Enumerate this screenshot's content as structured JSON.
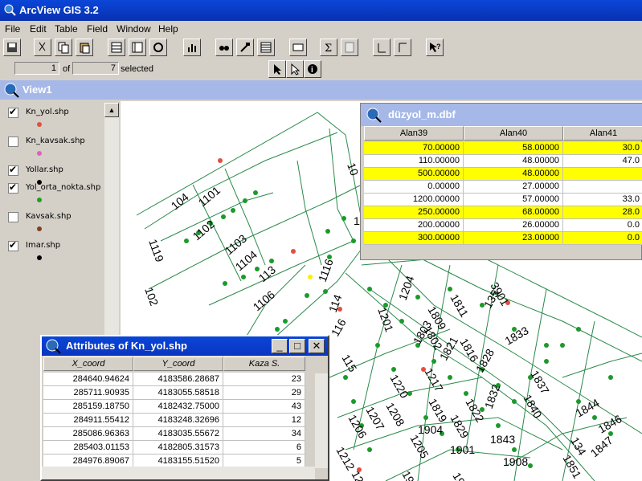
{
  "app": {
    "title": "ArcView GIS 3.2"
  },
  "menu": [
    "File",
    "Edit",
    "Table",
    "Field",
    "Window",
    "Help"
  ],
  "toolbar_icons": [
    "save-icon",
    "cut-icon",
    "copy-icon",
    "paste-icon",
    "select-all-icon",
    "select-none-icon",
    "switch-selection-icon",
    "chart-icon",
    "find-icon",
    "query-builder-icon",
    "summarize-icon",
    "join-icon",
    "calculate-icon",
    "sort-ascending-icon",
    "sort-descending-icon",
    "help-icon"
  ],
  "records": {
    "current": "1",
    "of_label": "of",
    "selected": "7",
    "selected_label": "selected"
  },
  "view": {
    "title": "View1"
  },
  "legend": [
    {
      "name": "Kn_yol.shp",
      "checked": true,
      "color": "#e05040"
    },
    {
      "name": "Kn_kavsak.shp",
      "checked": false,
      "color": "#e060c0"
    },
    {
      "name": "Yollar.shp",
      "checked": true,
      "color": "#000000"
    },
    {
      "name": "Yol_orta_nokta.shp",
      "checked": true,
      "color": "#20a020"
    },
    {
      "name": "Kavsak.shp",
      "checked": false,
      "color": "#804020"
    },
    {
      "name": "Imar.shp",
      "checked": true,
      "color": "#000000"
    }
  ],
  "dbf": {
    "title": "düzyol_m.dbf",
    "columns": [
      "Alan39",
      "Alan40",
      "Alan41"
    ],
    "rows": [
      {
        "cells": [
          "70.00000",
          "58.00000",
          "30.0"
        ],
        "selected": true
      },
      {
        "cells": [
          "110.00000",
          "48.00000",
          "47.0"
        ],
        "selected": false
      },
      {
        "cells": [
          "500.00000",
          "48.00000",
          ""
        ],
        "selected": true
      },
      {
        "cells": [
          "0.00000",
          "27.00000",
          ""
        ],
        "selected": false
      },
      {
        "cells": [
          "1200.00000",
          "57.00000",
          "33.0"
        ],
        "selected": false
      },
      {
        "cells": [
          "250.00000",
          "68.00000",
          "28.0"
        ],
        "selected": true
      },
      {
        "cells": [
          "200.00000",
          "26.00000",
          "0.0"
        ],
        "selected": false
      },
      {
        "cells": [
          "300.00000",
          "23.00000",
          "0.0"
        ],
        "selected": true
      }
    ]
  },
  "attributes": {
    "title": "Attributes of Kn_yol.shp",
    "columns": [
      "X_coord",
      "Y_coord",
      "Kaza S."
    ],
    "rows": [
      {
        "cells": [
          "284640.94624",
          "4183586.28687",
          "23"
        ],
        "selected": false
      },
      {
        "cells": [
          "285711.90935",
          "4183055.58518",
          "29"
        ],
        "selected": false
      },
      {
        "cells": [
          "285159.18750",
          "4182432.75000",
          "43"
        ],
        "selected": false
      },
      {
        "cells": [
          "284911.55412",
          "4183248.32696",
          "12"
        ],
        "selected": false
      },
      {
        "cells": [
          "285086.96363",
          "4183035.55672",
          "34"
        ],
        "selected": false
      },
      {
        "cells": [
          "285403.01153",
          "4182805.31573",
          "6"
        ],
        "selected": false
      },
      {
        "cells": [
          "284976.89067",
          "4183155.51520",
          "5"
        ],
        "selected": true
      }
    ]
  },
  "map_labels": [
    "104",
    "1101",
    "1102",
    "1103",
    "1104",
    "1119",
    "102",
    "113",
    "1106",
    "1116",
    "114",
    "116",
    "1201",
    "1204",
    "1809",
    "1811",
    "3901",
    "135",
    "1802",
    "1803",
    "1821",
    "1816",
    "1833",
    "1837",
    "1840",
    "1828",
    "1822",
    "1819",
    "1829",
    "1832",
    "1844",
    "1846",
    "1843",
    "134",
    "1851",
    "1847",
    "1908",
    "1901",
    "1904",
    "1903",
    "1911",
    "1212",
    "1215",
    "1206",
    "1207",
    "1208",
    "1205",
    "1220",
    "1217",
    "115",
    "11",
    "10"
  ],
  "colors": {
    "title_blue": "#0a46d8",
    "inactive_title": "#a6b8e8",
    "selection": "#ffff00",
    "map_line": "#2a8a4a",
    "point": "#1a9a2a"
  }
}
